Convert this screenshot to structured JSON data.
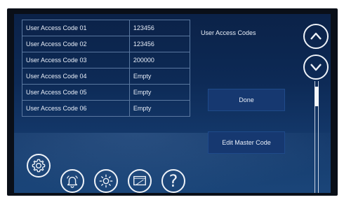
{
  "access_codes": {
    "rows": [
      {
        "label": "User Access Code 01",
        "value": "123456"
      },
      {
        "label": "User Access Code 02",
        "value": "123456"
      },
      {
        "label": "User Access Code 03",
        "value": "200000"
      },
      {
        "label": "User Access Code 04",
        "value": "Empty"
      },
      {
        "label": "User Access Code 05",
        "value": "Empty"
      },
      {
        "label": "User Access Code 06",
        "value": "Empty"
      }
    ]
  },
  "panel": {
    "title": "User Access Codes",
    "done_label": "Done",
    "edit_master_label": "Edit Master Code"
  },
  "scroll": {
    "up_icon": "chevron-up-icon",
    "down_icon": "chevron-down-icon",
    "position_fraction": 0.06
  },
  "nav": {
    "help_glyph": "?",
    "icons": [
      "settings-icon",
      "alarm-bell-icon",
      "brightness-icon",
      "display-icon",
      "help-icon"
    ]
  }
}
